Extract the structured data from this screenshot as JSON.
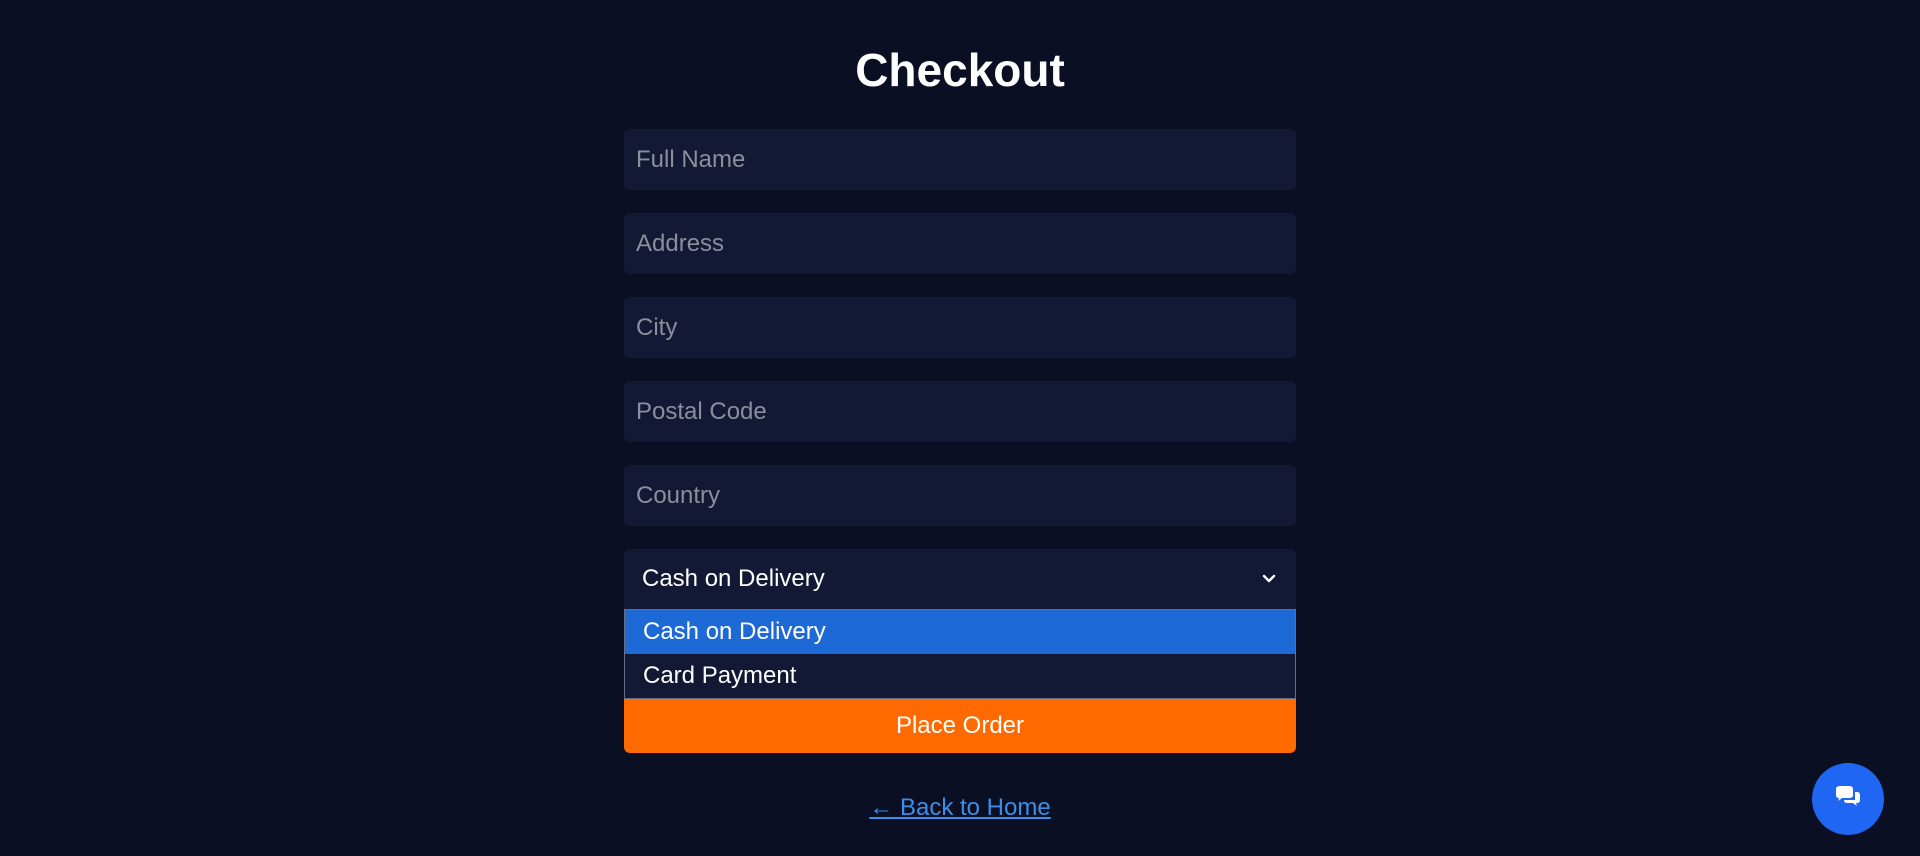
{
  "page": {
    "title": "Checkout"
  },
  "form": {
    "fields": [
      {
        "placeholder": "Full Name"
      },
      {
        "placeholder": "Address"
      },
      {
        "placeholder": "City"
      },
      {
        "placeholder": "Postal Code"
      },
      {
        "placeholder": "Country"
      }
    ],
    "payment_select": {
      "selected": "Cash on Delivery",
      "options": [
        "Cash on Delivery",
        "Card Payment"
      ]
    },
    "submit_label": "Place Order"
  },
  "footer": {
    "back_link": "← Back to Home"
  },
  "chat": {
    "icon": "chat-bubbles-icon"
  },
  "colors": {
    "background": "#0a0f23",
    "field_bg": "#131834",
    "accent": "#ff6a00",
    "selected_option": "#1d6ad6",
    "link": "#3b8eea",
    "chat_button": "#1f66f2"
  }
}
